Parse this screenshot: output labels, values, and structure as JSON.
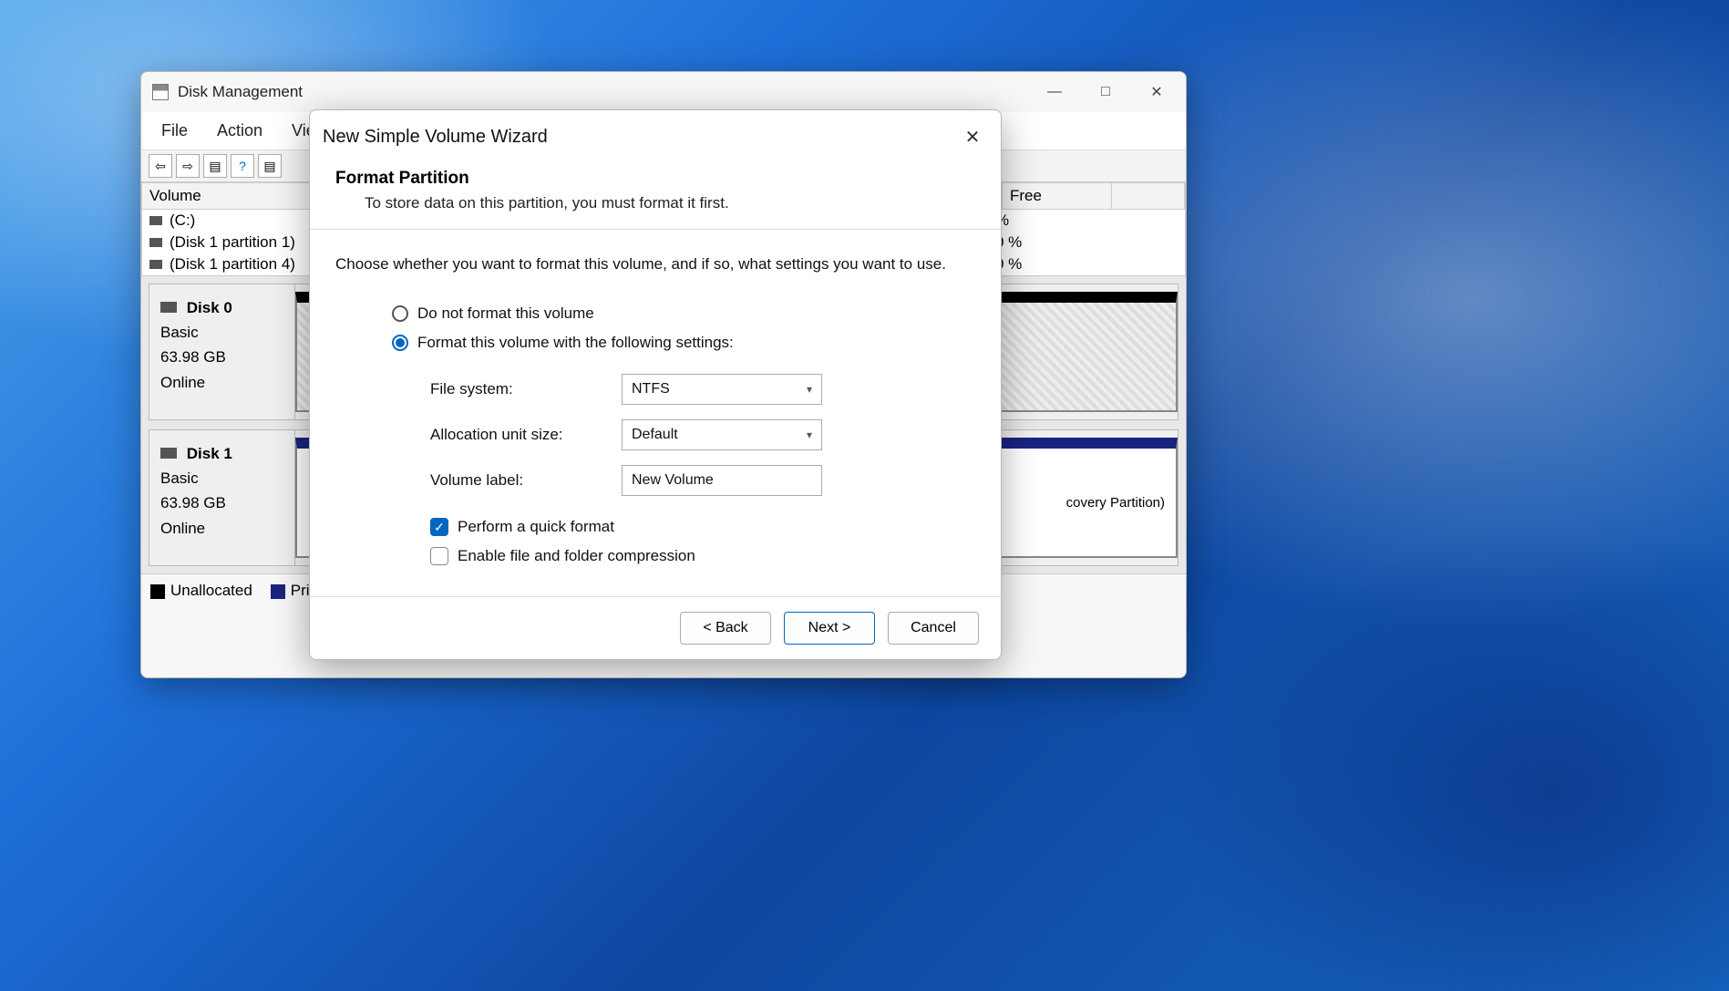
{
  "main_window": {
    "title": "Disk Management",
    "menu": [
      "File",
      "Action",
      "View"
    ],
    "table": {
      "headers": {
        "volume": "Volume",
        "free": "Free"
      },
      "rows": [
        {
          "name": "(C:)",
          "free": "%"
        },
        {
          "name": "(Disk 1 partition 1)",
          "free": "0 %"
        },
        {
          "name": "(Disk 1 partition 4)",
          "free": "0 %"
        }
      ]
    },
    "disks": [
      {
        "name": "Disk 0",
        "type": "Basic",
        "size": "63.98 GB",
        "status": "Online"
      },
      {
        "name": "Disk 1",
        "type": "Basic",
        "size": "63.98 GB",
        "status": "Online",
        "right_label": "covery Partition)"
      }
    ],
    "legend": {
      "unallocated": "Unallocated",
      "primary": "Pri"
    }
  },
  "wizard": {
    "title": "New Simple Volume Wizard",
    "heading": "Format Partition",
    "subheading": "To store data on this partition, you must format it first.",
    "intro": "Choose whether you want to format this volume, and if so, what settings you want to use.",
    "radio1": "Do not format this volume",
    "radio2": "Format this volume with the following settings:",
    "fields": {
      "fs_label": "File system:",
      "fs_value": "NTFS",
      "aus_label": "Allocation unit size:",
      "aus_value": "Default",
      "vl_label": "Volume label:",
      "vl_value": "New Volume"
    },
    "check1": "Perform a quick format",
    "check2": "Enable file and folder compression",
    "buttons": {
      "back": "< Back",
      "next": "Next >",
      "cancel": "Cancel"
    }
  }
}
